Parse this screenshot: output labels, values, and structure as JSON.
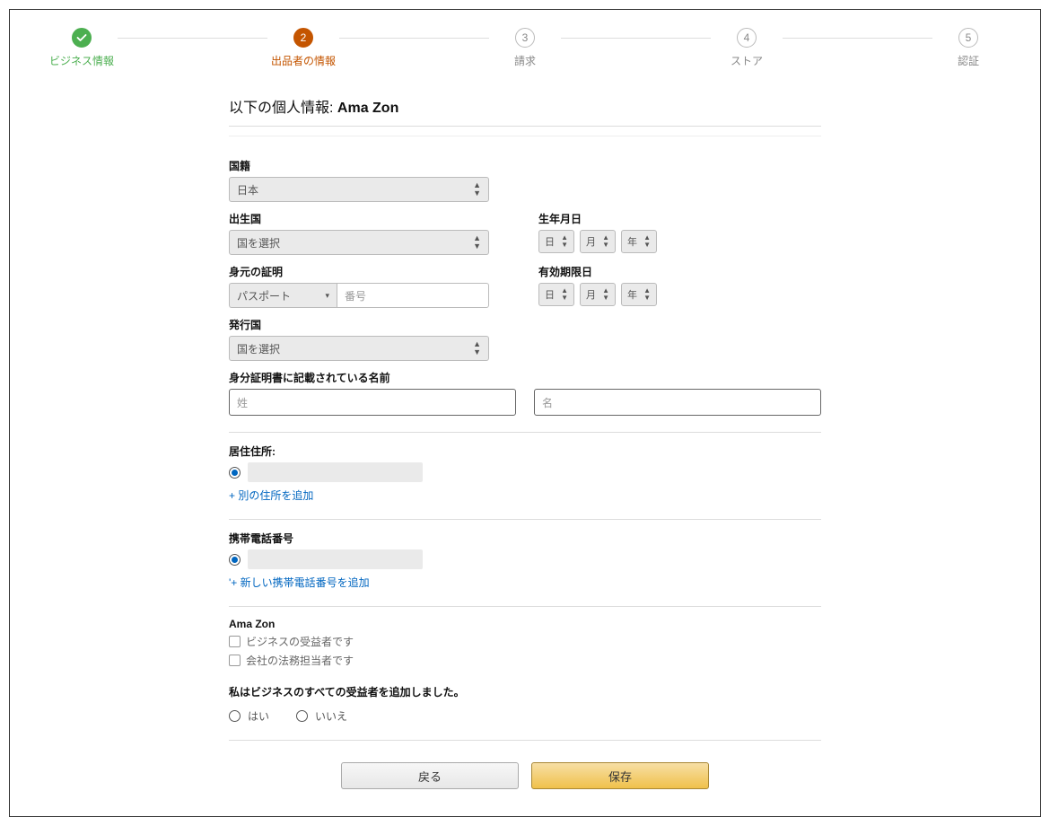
{
  "stepper": {
    "steps": [
      {
        "num": "",
        "label": "ビジネス情報",
        "state": "done"
      },
      {
        "num": "2",
        "label": "出品者の情報",
        "state": "active"
      },
      {
        "num": "3",
        "label": "請求",
        "state": "inactive"
      },
      {
        "num": "4",
        "label": "ストア",
        "state": "inactive"
      },
      {
        "num": "5",
        "label": "認証",
        "state": "inactive"
      }
    ]
  },
  "title": {
    "prefix": "以下の個人情報: ",
    "name": "Ama Zon"
  },
  "form": {
    "nationality_label": "国籍",
    "nationality_value": "日本",
    "birth_country_label": "出生国",
    "birth_country_value": "国を選択",
    "dob_label": "生年月日",
    "dob_day": "日",
    "dob_month": "月",
    "dob_year": "年",
    "id_proof_label": "身元の証明",
    "id_proof_value": "パスポート",
    "id_number_placeholder": "番号",
    "expiry_label": "有効期限日",
    "expiry_day": "日",
    "expiry_month": "月",
    "expiry_year": "年",
    "issue_country_label": "発行国",
    "issue_country_value": "国を選択",
    "id_name_label": "身分証明書に記載されている名前",
    "lastname_placeholder": "姓",
    "firstname_placeholder": "名",
    "address_label": "居住住所:",
    "add_address_link": "+ 別の住所を追加",
    "phone_label": "携帯電話番号",
    "add_phone_link": "'+ 新しい携帯電話番号を追加",
    "owner_name": "Ama Zon",
    "chk_beneficiary": "ビジネスの受益者です",
    "chk_legal_rep": "会社の法務担当者です",
    "all_added_label": "私はビジネスのすべての受益者を追加しました。",
    "yes_label": "はい",
    "no_label": "いいえ"
  },
  "buttons": {
    "back": "戻る",
    "save": "保存"
  }
}
